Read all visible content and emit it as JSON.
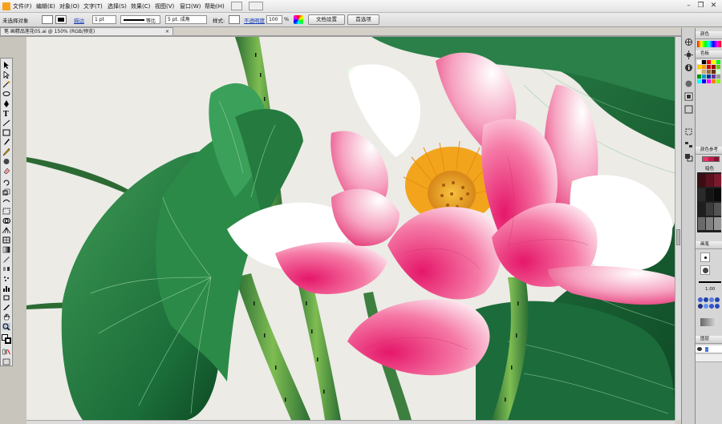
{
  "menu": {
    "items": [
      "文件(F)",
      "编辑(E)",
      "对象(O)",
      "文字(T)",
      "选择(S)",
      "效果(C)",
      "视图(V)",
      "窗口(W)",
      "帮助(H)"
    ]
  },
  "window_controls": {
    "minimize": "–",
    "restore": "❐",
    "close": "✕"
  },
  "control_bar": {
    "selection_status": "未选择对象",
    "stroke_label": "描边",
    "stroke_weight": "1 pt",
    "profile_label": "等比",
    "brush_label": "5 pt. 成角",
    "style_label": "样式:",
    "opacity_label": "不透明度",
    "opacity_value": "100",
    "opacity_unit": "%",
    "doc_setup_button": "文档设置",
    "preferences_button": "首选项"
  },
  "document_tab": {
    "title": "笔 画精品莲花05.ai @ 150% (RGB/预览)",
    "close": "×"
  },
  "panels": {
    "color": {
      "title": "颜色"
    },
    "swatches": {
      "title": "色板"
    },
    "color_guide": {
      "title": "颜色参考",
      "sub_label": "暗色"
    },
    "brushes": {
      "title": "画笔"
    },
    "stroke": {
      "value": "1.00"
    },
    "layers": {
      "title": "图层"
    }
  },
  "colors": {
    "swatch_row1": [
      "#ffffff",
      "#000000",
      "#ff0000",
      "#ffff00",
      "#00ff00",
      "#00ffff",
      "#0000ff",
      "#ff00ff",
      "#ff7f00",
      "#7fff00"
    ],
    "swatch_row2": [
      "#ffcc00",
      "#ff9900",
      "#cc0000",
      "#990000",
      "#66cc00",
      "#009900",
      "#0099cc",
      "#003399",
      "#663399",
      "#999999"
    ],
    "swatch_row3": [
      "#ffeecc",
      "#ccaa77",
      "#996633",
      "#663300",
      "#ccffcc",
      "#66cccc",
      "#99ccff",
      "#cc99ff",
      "#ff99cc",
      "#333333"
    ],
    "guide_dark": [
      "#3a0d14",
      "#5a1220",
      "#7a1a2c",
      "#2a2a2a",
      "#141414",
      "#0a0a0a",
      "#1e1e1e",
      "#3c3c3c",
      "#545454",
      "#6a6a6a",
      "#808080",
      "#969696"
    ],
    "accent_pink": "#e8336d",
    "leaf_green": "#1f7a3e",
    "stamen_gold": "#f2a51c"
  }
}
